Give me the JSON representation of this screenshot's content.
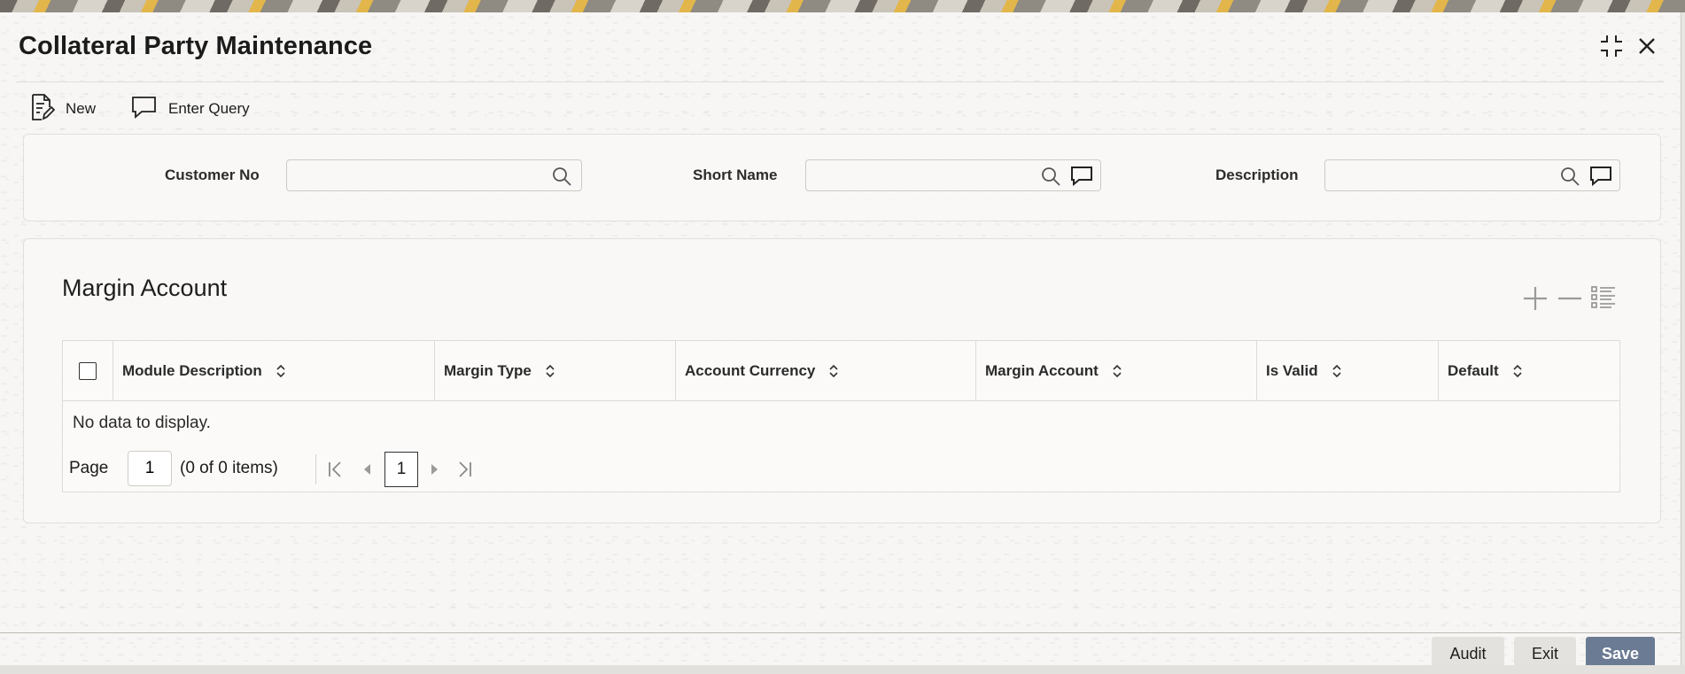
{
  "window": {
    "title": "Collateral Party Maintenance",
    "controls": [
      "collapse-icon",
      "close-icon"
    ]
  },
  "toolbar": {
    "new_label": "New",
    "enter_query_label": "Enter Query"
  },
  "query_fields": {
    "customer_no": {
      "label": "Customer No",
      "value": ""
    },
    "short_name": {
      "label": "Short Name",
      "value": ""
    },
    "description": {
      "label": "Description",
      "value": ""
    }
  },
  "margin_account": {
    "title": "Margin Account",
    "actions": [
      "add-row-icon",
      "remove-row-icon",
      "single-record-view-icon"
    ],
    "columns": [
      "Module Description",
      "Margin Type",
      "Account Currency",
      "Margin Account",
      "Is Valid",
      "Default"
    ],
    "rows": [],
    "empty_message": "No data to display.",
    "pagination": {
      "page_label": "Page",
      "page_input": "1",
      "items_text": "(0 of 0 items)",
      "current_page": "1"
    }
  },
  "footer": {
    "audit_label": "Audit",
    "exit_label": "Exit",
    "save_label": "Save"
  },
  "colors": {
    "primary_button": "#6b7b93",
    "panel_border": "#e2dfda"
  }
}
